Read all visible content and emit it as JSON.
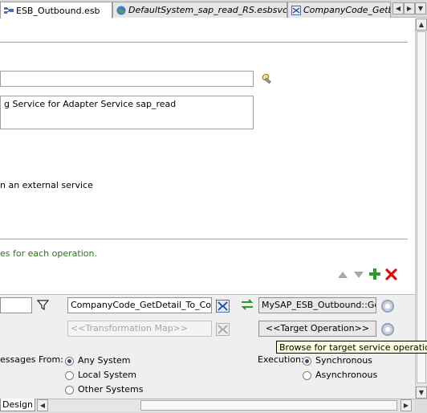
{
  "tabs": [
    {
      "label": "ESB_Outbound.esb",
      "active": true
    },
    {
      "label": "DefaultSystem_sap_read_RS.esbsvc",
      "active": false
    },
    {
      "label": "CompanyCode_GetDe",
      "active": false
    }
  ],
  "form": {
    "name_field_value": "",
    "description_value": "g Service for Adapter Service sap_read",
    "external_service_text": "n an external service",
    "operations_hint": "es for each operation."
  },
  "routing": {
    "filter_value": "",
    "transformation_value": "CompanyCode_GetDetail_To_Compa",
    "target_value": "MySAP_ESB_Outbound::GetD",
    "transformation_map_placeholder": "<<Transformation Map>>",
    "target_operation_placeholder": "<<Target Operation>>",
    "tooltip": "Browse for target service operations.",
    "messages_from_label": "essages From:",
    "execution_label": "Execution:",
    "messages_from_options": [
      "Any System",
      "Local System",
      "Other Systems"
    ],
    "execution_options": [
      "Synchronous",
      "Asynchronous"
    ],
    "messages_from_selected": "Any System",
    "execution_selected": "Synchronous"
  },
  "bottom": {
    "design_tab": "Design"
  },
  "colors": {
    "hint_green": "#2e6f1f",
    "add_green": "#2e9a2e",
    "delete_red": "#cc1111"
  }
}
